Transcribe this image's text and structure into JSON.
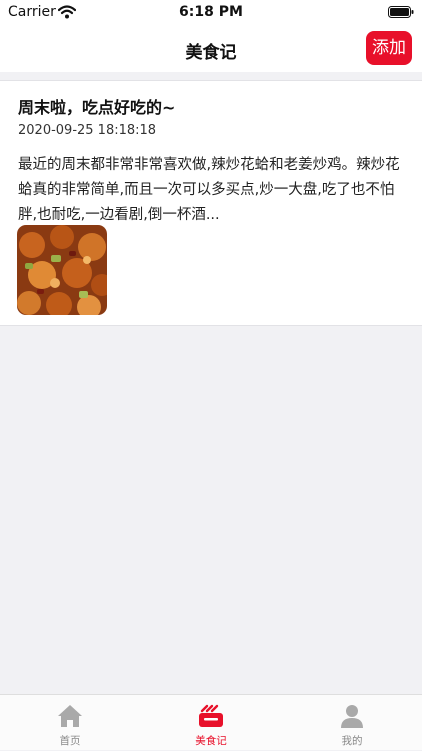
{
  "status_bar": {
    "carrier": "Carrier",
    "time": "6:18 PM"
  },
  "nav": {
    "title": "美食记",
    "add_label": "添加"
  },
  "post": {
    "title": "周末啦，吃点好吃的~",
    "time": "2020-09-25 18:18:18",
    "body": "最近的周末都非常非常喜欢做,辣炒花蛤和老姜炒鸡。辣炒花蛤真的非常简单,而且一次可以多买点,炒一大盘,吃了也不怕胖,也耐吃,一边看剧,倒一杯酒..."
  },
  "tabs": [
    {
      "label": "首页",
      "icon": "home-icon"
    },
    {
      "label": "美食记",
      "icon": "food-journal-icon"
    },
    {
      "label": "我的",
      "icon": "profile-icon"
    }
  ],
  "colors": {
    "accent": "#e8102a",
    "inactive": "#a9a9a9"
  }
}
